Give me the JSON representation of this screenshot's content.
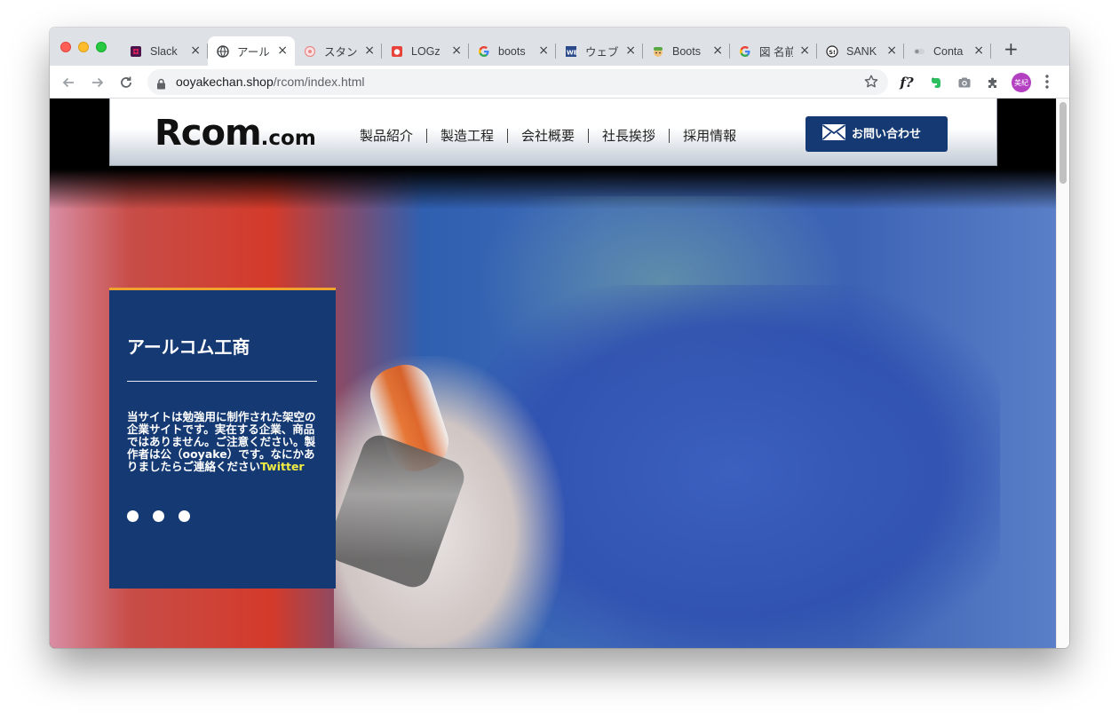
{
  "browser": {
    "tabs": [
      {
        "title": "Slack",
        "icon": "slack-icon",
        "active": false
      },
      {
        "title": "アール",
        "icon": "globe-icon",
        "active": true
      },
      {
        "title": "スタン",
        "icon": "stamp-favicon-icon",
        "active": false
      },
      {
        "title": "LOGz",
        "icon": "logz-favicon-icon",
        "active": false
      },
      {
        "title": "boots",
        "icon": "google-icon",
        "active": false
      },
      {
        "title": "ウェブ",
        "icon": "wb-favicon-icon",
        "active": false
      },
      {
        "title": "Boots",
        "icon": "character-favicon-icon",
        "active": false
      },
      {
        "title": "図 名前",
        "icon": "google-icon",
        "active": false
      },
      {
        "title": "SANK",
        "icon": "sank-favicon-icon",
        "active": false
      },
      {
        "title": "Conta",
        "icon": "toggle-favicon-icon",
        "active": false
      }
    ],
    "close_glyph": "×",
    "new_tab_glyph": "+",
    "url_host": "ooyakechan.shop",
    "url_path": "/rcom/index.html",
    "extension_f_label": "f?",
    "profile_initials": "美紀"
  },
  "site": {
    "logo_main": "Rcom",
    "logo_sub": ".com",
    "nav": [
      "製品紹介",
      "製造工程",
      "会社概要",
      "社長挨拶",
      "採用情報"
    ],
    "contact_label": "お問い合わせ",
    "panel": {
      "title": "アールコム工商",
      "text": "当サイトは勉強用に制作された架空の企業サイトです。実在する企業、商品ではありません。ご注意ください。製作者は公（ooyake）です。なにかありましたらご連絡ください",
      "link": "Twitter",
      "slide_count": 3
    }
  },
  "colors": {
    "brand_navy": "#153a73",
    "accent_orange": "#f0a22e",
    "link_yellow": "#f1ed43"
  }
}
